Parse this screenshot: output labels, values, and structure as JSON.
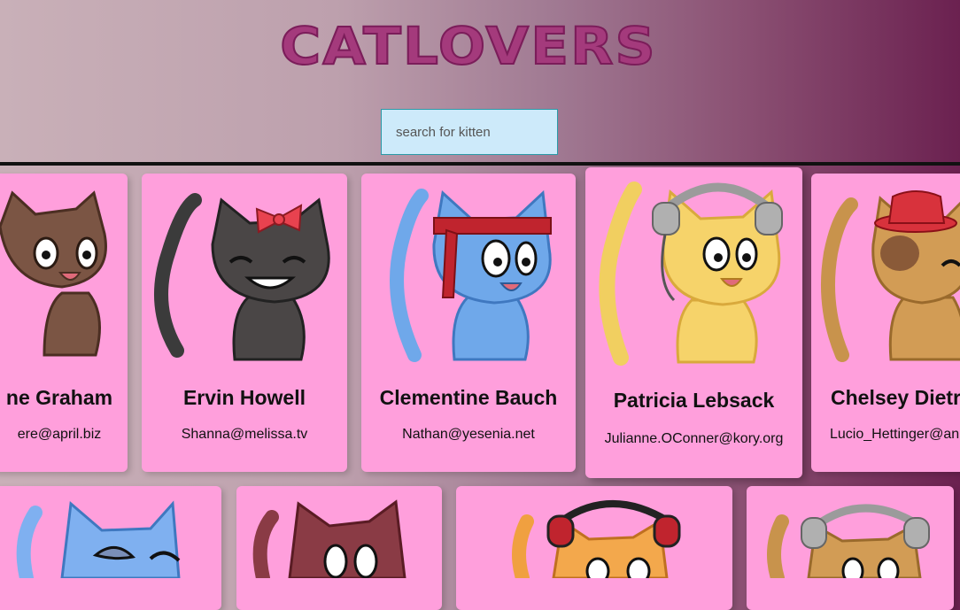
{
  "header": {
    "title": "CATLOVERS",
    "search_placeholder": "search for kitten"
  },
  "colors": {
    "card": "#ff9fdc",
    "title": "#a43a7c",
    "search_bg": "#cdeafa"
  },
  "cats": [
    {
      "name": "ne Graham",
      "email": "ere@april.biz",
      "icon": "brown-cat-icon"
    },
    {
      "name": "Ervin Howell",
      "email": "Shanna@melissa.tv",
      "icon": "black-cat-with-bow-icon"
    },
    {
      "name": "Clementine Bauch",
      "email": "Nathan@yesenia.net",
      "icon": "blue-cat-with-headband-icon"
    },
    {
      "name": "Patricia Lebsack",
      "email": "Julianne.OConner@kory.org",
      "icon": "yellow-cat-with-headphones-icon"
    },
    {
      "name": "Chelsey Dietr",
      "email": "Lucio_Hettinger@an",
      "icon": "tan-cat-with-hat-icon"
    },
    {
      "name": "",
      "email": "",
      "icon": "blue-cat-icon"
    },
    {
      "name": "",
      "email": "",
      "icon": "maroon-cat-icon"
    },
    {
      "name": "",
      "email": "",
      "icon": "orange-cat-with-headphones-icon"
    },
    {
      "name": "",
      "email": "",
      "icon": "tan-cat-with-headphones-icon"
    }
  ]
}
